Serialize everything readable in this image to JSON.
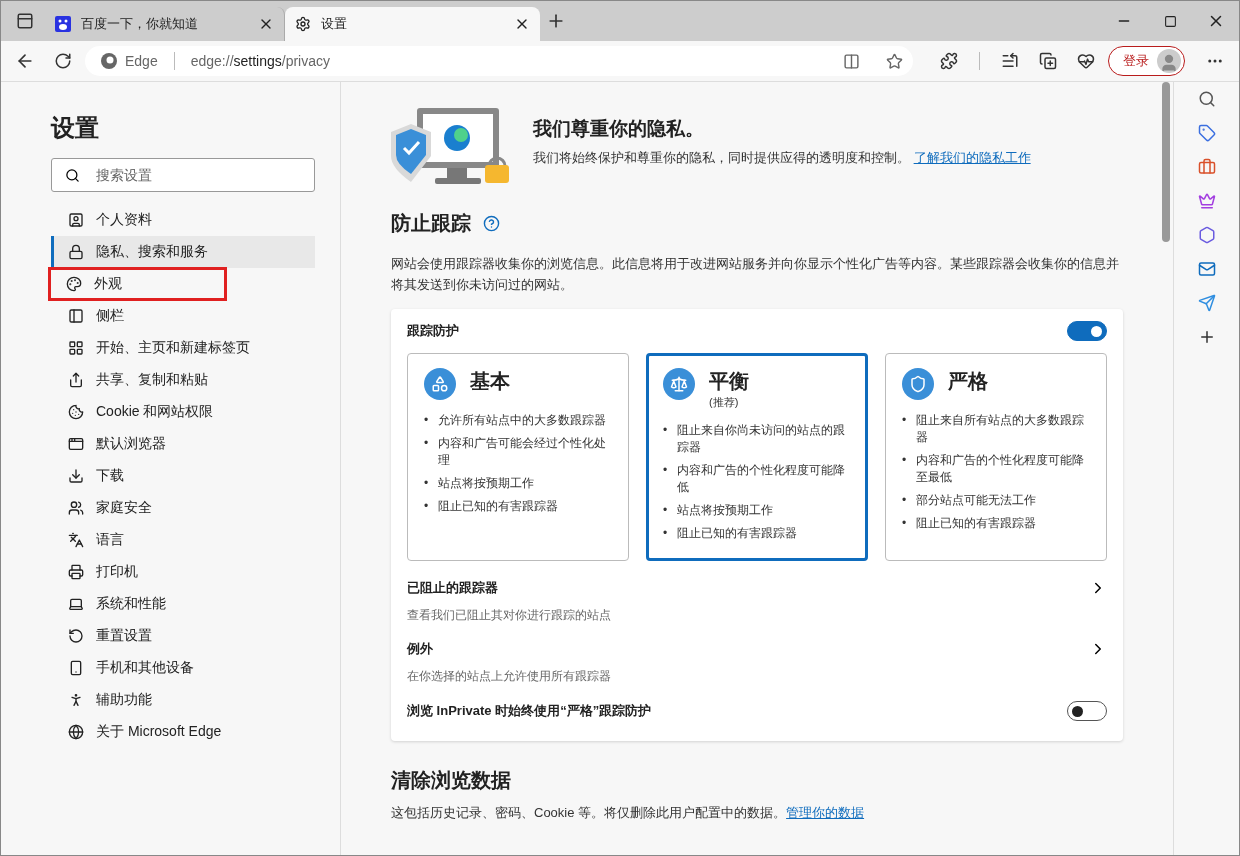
{
  "tabs": [
    {
      "title": "百度一下，你就知道",
      "kind": "baidu",
      "selected": false
    },
    {
      "title": "设置",
      "kind": "settings",
      "selected": true
    }
  ],
  "address_bar": {
    "brand": "Edge",
    "url_prefix": "edge://",
    "url_main": "settings",
    "url_suffix": "/privacy"
  },
  "login_button": "登录",
  "sidebar": {
    "title": "设置",
    "search": {
      "placeholder": "搜索设置"
    },
    "items": [
      {
        "label": "个人资料",
        "selected": false,
        "highlighted": false
      },
      {
        "label": "隐私、搜索和服务",
        "selected": true,
        "highlighted": false
      },
      {
        "label": "外观",
        "selected": false,
        "highlighted": true
      },
      {
        "label": "侧栏",
        "selected": false,
        "highlighted": false
      },
      {
        "label": "开始、主页和新建标签页",
        "selected": false,
        "highlighted": false
      },
      {
        "label": "共享、复制和粘贴",
        "selected": false,
        "highlighted": false
      },
      {
        "label": "Cookie 和网站权限",
        "selected": false,
        "highlighted": false
      },
      {
        "label": "默认浏览器",
        "selected": false,
        "highlighted": false
      },
      {
        "label": "下载",
        "selected": false,
        "highlighted": false
      },
      {
        "label": "家庭安全",
        "selected": false,
        "highlighted": false
      },
      {
        "label": "语言",
        "selected": false,
        "highlighted": false
      },
      {
        "label": "打印机",
        "selected": false,
        "highlighted": false
      },
      {
        "label": "系统和性能",
        "selected": false,
        "highlighted": false
      },
      {
        "label": "重置设置",
        "selected": false,
        "highlighted": false
      },
      {
        "label": "手机和其他设备",
        "selected": false,
        "highlighted": false
      },
      {
        "label": "辅助功能",
        "selected": false,
        "highlighted": false
      },
      {
        "label": "关于 Microsoft Edge",
        "selected": false,
        "highlighted": false
      }
    ]
  },
  "privacy_header": {
    "title": "我们尊重你的隐私。",
    "text": "我们将始终保护和尊重你的隐私，同时提供应得的透明度和控制。",
    "link": "了解我们的隐私工作"
  },
  "tracking": {
    "title": "防止跟踪",
    "description": "网站会使用跟踪器收集你的浏览信息。此信息将用于改进网站服务并向你显示个性化广告等内容。某些跟踪器会收集你的信息并将其发送到你未访问过的网站。",
    "card_title": "跟踪防护",
    "enabled": true,
    "bullet_marker": "•",
    "levels": [
      {
        "name": "基本",
        "kind": "basic",
        "selected": false,
        "bullets": [
          "允许所有站点中的大多数跟踪器",
          "内容和广告可能会经过个性化处理",
          "站点将按预期工作",
          "阻止已知的有害跟踪器"
        ]
      },
      {
        "name": "平衡",
        "kind": "balanced",
        "subtitle": "(推荐)",
        "selected": true,
        "bullets": [
          "阻止来自你尚未访问的站点的跟踪器",
          "内容和广告的个性化程度可能降低",
          "站点将按预期工作",
          "阻止已知的有害跟踪器"
        ]
      },
      {
        "name": "严格",
        "kind": "strict",
        "selected": false,
        "bullets": [
          "阻止来自所有站点的大多数跟踪器",
          "内容和广告的个性化程度可能降至最低",
          "部分站点可能无法工作",
          "阻止已知的有害跟踪器"
        ]
      }
    ],
    "rows": [
      {
        "kind": "link",
        "title": "已阻止的跟踪器",
        "subtitle": "查看我们已阻止其对你进行跟踪的站点"
      },
      {
        "kind": "link",
        "title": "例外",
        "subtitle": "在你选择的站点上允许使用所有跟踪器"
      },
      {
        "kind": "toggle",
        "title": "浏览 InPrivate 时始终使用“严格”跟踪防护",
        "on": false
      }
    ]
  },
  "clear_data": {
    "title": "清除浏览数据",
    "text": "这包括历史记录、密码、Cookie 等。将仅删除此用户配置中的数据。",
    "link": "管理你的数据"
  }
}
